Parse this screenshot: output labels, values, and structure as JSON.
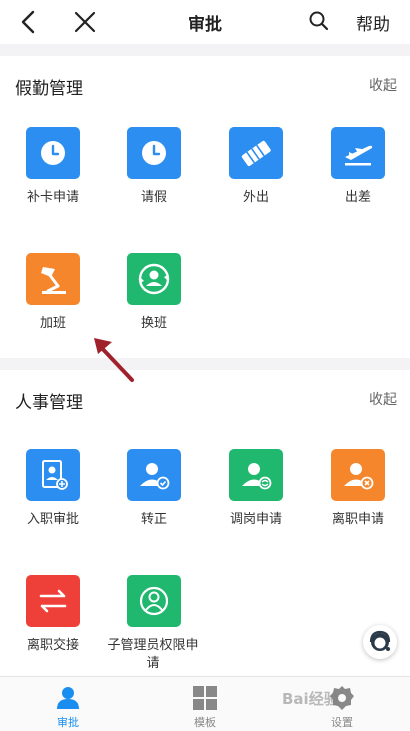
{
  "header": {
    "title": "审批",
    "help_label": "帮助"
  },
  "sections": [
    {
      "title": "假勤管理",
      "collapse_label": "收起",
      "items": [
        {
          "label": "补卡申请",
          "icon": "clock-icon",
          "color": "#2b8ef0"
        },
        {
          "label": "请假",
          "icon": "clock-icon",
          "color": "#2b8ef0"
        },
        {
          "label": "外出",
          "icon": "handshake-icon",
          "color": "#2b8ef0"
        },
        {
          "label": "出差",
          "icon": "airplane-icon",
          "color": "#2b8ef0"
        },
        {
          "label": "加班",
          "icon": "desk-lamp-icon",
          "color": "#f5862b"
        },
        {
          "label": "换班",
          "icon": "shift-swap-icon",
          "color": "#1fb86e"
        }
      ]
    },
    {
      "title": "人事管理",
      "collapse_label": "收起",
      "items": [
        {
          "label": "入职审批",
          "icon": "onboard-icon",
          "color": "#2b8ef0"
        },
        {
          "label": "转正",
          "icon": "user-check-icon",
          "color": "#2b8ef0"
        },
        {
          "label": "调岗申请",
          "icon": "user-transfer-icon",
          "color": "#1fb86e"
        },
        {
          "label": "离职申请",
          "icon": "user-remove-icon",
          "color": "#f5862b"
        },
        {
          "label": "离职交接",
          "icon": "exchange-arrows-icon",
          "color": "#ef3f39"
        },
        {
          "label": "子管理员权限申请",
          "icon": "admin-user-icon",
          "color": "#1fb86e"
        }
      ]
    }
  ],
  "tabbar": {
    "items": [
      {
        "label": "审批",
        "icon": "approval-icon",
        "active": true
      },
      {
        "label": "模板",
        "icon": "template-icon",
        "active": false
      },
      {
        "label": "设置",
        "icon": "settings-gear-icon",
        "active": false
      }
    ]
  },
  "watermark": "Bai经验",
  "colors": {
    "accent": "#1a8ef0",
    "blue": "#2b8ef0",
    "orange": "#f5862b",
    "green": "#1fb86e",
    "red": "#ef3f39",
    "annotation_arrow": "#a0212b"
  }
}
